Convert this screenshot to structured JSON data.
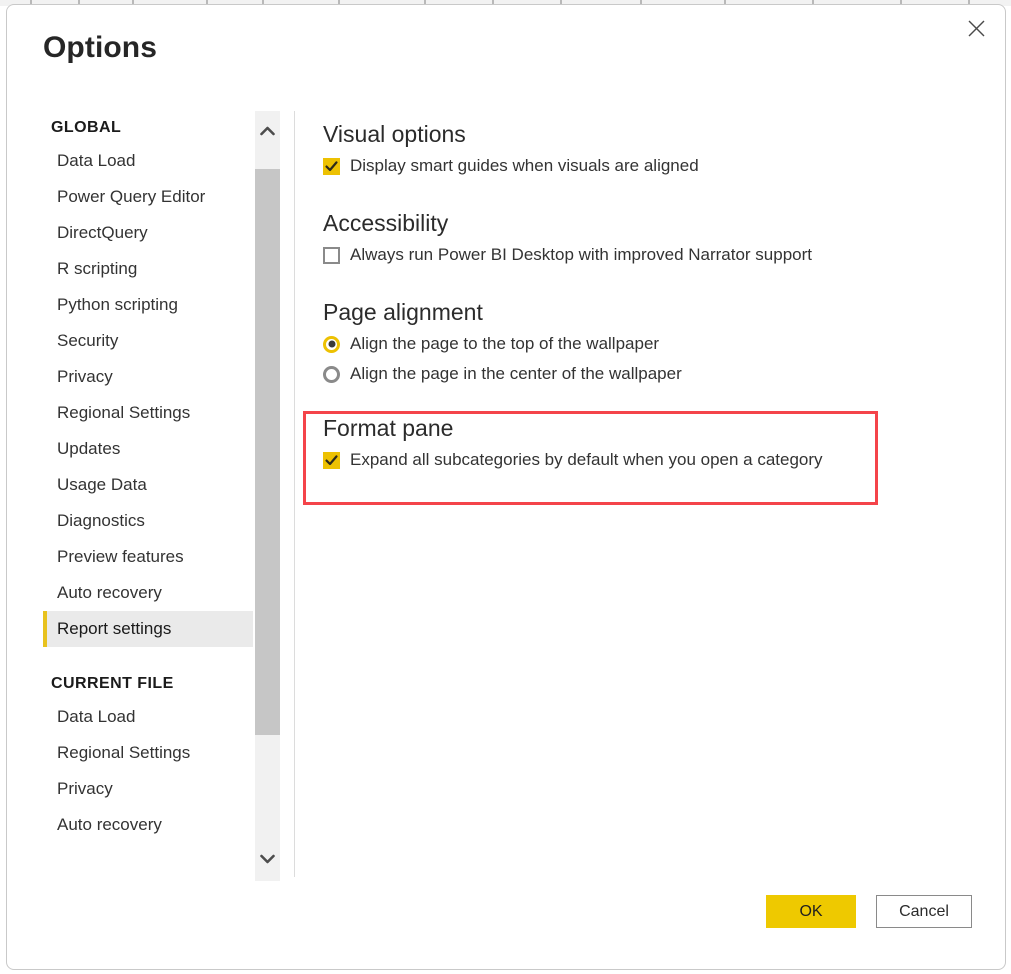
{
  "window": {
    "title": "Options",
    "close_icon": "close-icon"
  },
  "sidebar": {
    "groups": [
      {
        "heading": "GLOBAL",
        "items": [
          {
            "label": "Data Load",
            "selected": false
          },
          {
            "label": "Power Query Editor",
            "selected": false
          },
          {
            "label": "DirectQuery",
            "selected": false
          },
          {
            "label": "R scripting",
            "selected": false
          },
          {
            "label": "Python scripting",
            "selected": false
          },
          {
            "label": "Security",
            "selected": false
          },
          {
            "label": "Privacy",
            "selected": false
          },
          {
            "label": "Regional Settings",
            "selected": false
          },
          {
            "label": "Updates",
            "selected": false
          },
          {
            "label": "Usage Data",
            "selected": false
          },
          {
            "label": "Diagnostics",
            "selected": false
          },
          {
            "label": "Preview features",
            "selected": false
          },
          {
            "label": "Auto recovery",
            "selected": false
          },
          {
            "label": "Report settings",
            "selected": true
          }
        ]
      },
      {
        "heading": "CURRENT FILE",
        "items": [
          {
            "label": "Data Load",
            "selected": false
          },
          {
            "label": "Regional Settings",
            "selected": false
          },
          {
            "label": "Privacy",
            "selected": false
          },
          {
            "label": "Auto recovery",
            "selected": false
          }
        ]
      }
    ],
    "scrollbar": {
      "up_icon": "chevron-up-icon",
      "down_icon": "chevron-down-icon"
    }
  },
  "content": {
    "sections": [
      {
        "heading": "Visual options",
        "options": [
          {
            "type": "checkbox",
            "label": "Display smart guides when visuals are aligned",
            "checked": true
          }
        ]
      },
      {
        "heading": "Accessibility",
        "options": [
          {
            "type": "checkbox",
            "label": "Always run Power BI Desktop with improved Narrator support",
            "checked": false
          }
        ]
      },
      {
        "heading": "Page alignment",
        "options": [
          {
            "type": "radio",
            "label": "Align the page to the top of the wallpaper",
            "selected": true
          },
          {
            "type": "radio",
            "label": "Align the page in the center of the wallpaper",
            "selected": false
          }
        ]
      },
      {
        "heading": "Format pane",
        "highlighted": true,
        "options": [
          {
            "type": "checkbox",
            "label": "Expand all subcategories by default when you open a category",
            "checked": true
          }
        ]
      }
    ]
  },
  "footer": {
    "ok_label": "OK",
    "cancel_label": "Cancel"
  },
  "colors": {
    "accent_yellow": "#edc102",
    "ok_button": "#eec900",
    "highlight_red": "#f4444a",
    "selected_nav_bg": "#eaeaea",
    "text": "#333333"
  }
}
